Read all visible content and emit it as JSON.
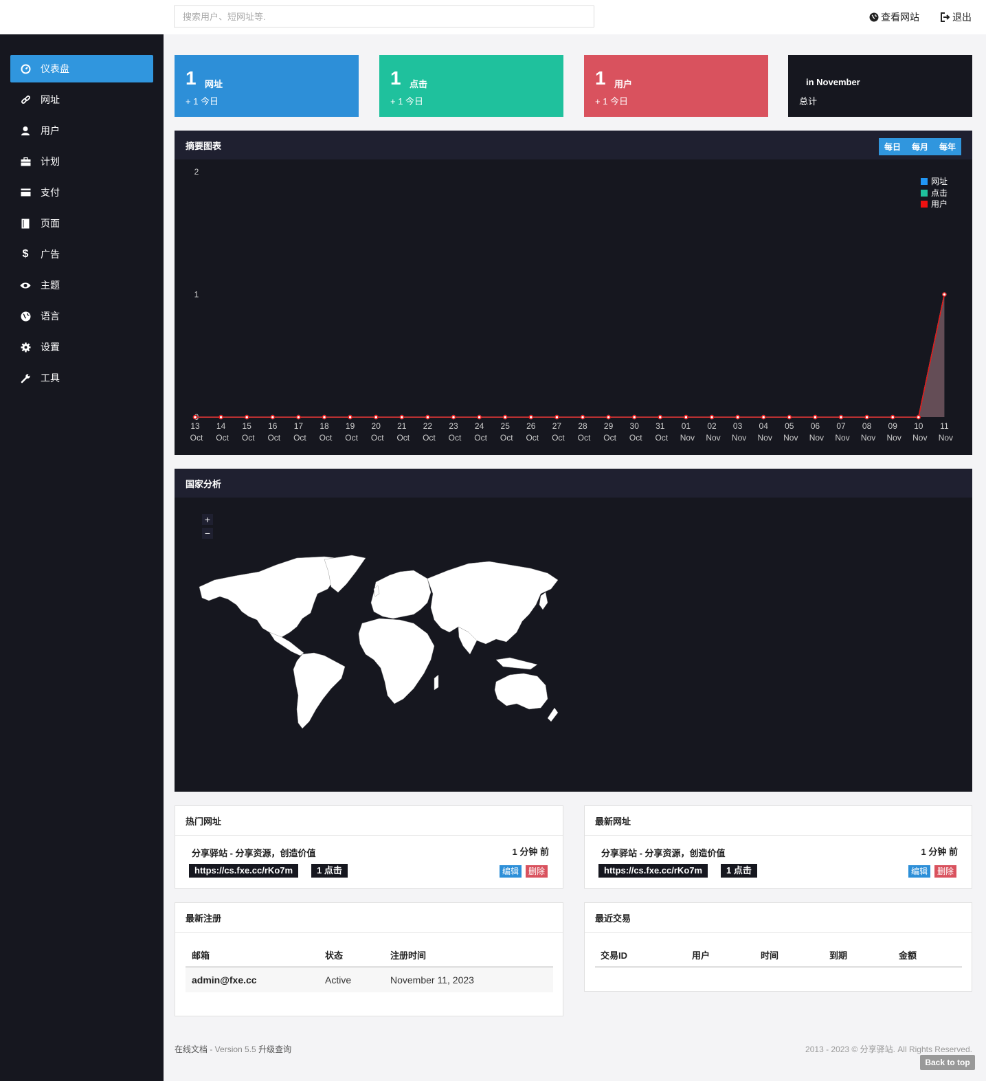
{
  "header": {
    "search_placeholder": "搜索用户、短网址等.",
    "view_site": "查看网站",
    "logout": "退出"
  },
  "sidebar": {
    "items": [
      {
        "label": "仪表盘",
        "icon": "dashboard-icon",
        "active": true
      },
      {
        "label": "网址",
        "icon": "link-icon"
      },
      {
        "label": "用户",
        "icon": "user-icon"
      },
      {
        "label": "计划",
        "icon": "briefcase-icon"
      },
      {
        "label": "支付",
        "icon": "credit-card-icon"
      },
      {
        "label": "页面",
        "icon": "page-icon"
      },
      {
        "label": "广告",
        "icon": "dollar-icon"
      },
      {
        "label": "主题",
        "icon": "eye-icon"
      },
      {
        "label": "语言",
        "icon": "globe-icon"
      },
      {
        "label": "设置",
        "icon": "gear-icon"
      },
      {
        "label": "工具",
        "icon": "wrench-icon"
      }
    ]
  },
  "stats": [
    {
      "num": "1",
      "label": "网址",
      "sub": "+ 1 今日",
      "color": "#2d8fd8"
    },
    {
      "num": "1",
      "label": "点击",
      "sub": "+ 1 今日",
      "color": "#1fc19d"
    },
    {
      "num": "1",
      "label": "用户",
      "sub": "+ 1 今日",
      "color": "#d9525e"
    },
    {
      "num": "",
      "label": "in November",
      "sub": "总计",
      "color": "#16171f"
    }
  ],
  "summary": {
    "title": "摘要图表",
    "periods": [
      "每日",
      "每月",
      "每年"
    ]
  },
  "chart_data": {
    "type": "area",
    "y_ticks": [
      "2",
      "1",
      "0"
    ],
    "ylim": [
      0,
      2
    ],
    "categories": [
      [
        "13",
        "Oct"
      ],
      [
        "14",
        "Oct"
      ],
      [
        "15",
        "Oct"
      ],
      [
        "16",
        "Oct"
      ],
      [
        "17",
        "Oct"
      ],
      [
        "18",
        "Oct"
      ],
      [
        "19",
        "Oct"
      ],
      [
        "20",
        "Oct"
      ],
      [
        "21",
        "Oct"
      ],
      [
        "22",
        "Oct"
      ],
      [
        "23",
        "Oct"
      ],
      [
        "24",
        "Oct"
      ],
      [
        "25",
        "Oct"
      ],
      [
        "26",
        "Oct"
      ],
      [
        "27",
        "Oct"
      ],
      [
        "28",
        "Oct"
      ],
      [
        "29",
        "Oct"
      ],
      [
        "30",
        "Oct"
      ],
      [
        "31",
        "Oct"
      ],
      [
        "01",
        "Nov"
      ],
      [
        "02",
        "Nov"
      ],
      [
        "03",
        "Nov"
      ],
      [
        "04",
        "Nov"
      ],
      [
        "05",
        "Nov"
      ],
      [
        "06",
        "Nov"
      ],
      [
        "07",
        "Nov"
      ],
      [
        "08",
        "Nov"
      ],
      [
        "09",
        "Nov"
      ],
      [
        "10",
        "Nov"
      ],
      [
        "11",
        "Nov"
      ]
    ],
    "series": [
      {
        "name": "网址",
        "color": "#2196f3",
        "values": [
          0,
          0,
          0,
          0,
          0,
          0,
          0,
          0,
          0,
          0,
          0,
          0,
          0,
          0,
          0,
          0,
          0,
          0,
          0,
          0,
          0,
          0,
          0,
          0,
          0,
          0,
          0,
          0,
          0,
          1
        ]
      },
      {
        "name": "点击",
        "color": "#1fc19d",
        "values": [
          0,
          0,
          0,
          0,
          0,
          0,
          0,
          0,
          0,
          0,
          0,
          0,
          0,
          0,
          0,
          0,
          0,
          0,
          0,
          0,
          0,
          0,
          0,
          0,
          0,
          0,
          0,
          0,
          0,
          1
        ]
      },
      {
        "name": "用户",
        "color": "#ee1111",
        "values": [
          0,
          0,
          0,
          0,
          0,
          0,
          0,
          0,
          0,
          0,
          0,
          0,
          0,
          0,
          0,
          0,
          0,
          0,
          0,
          0,
          0,
          0,
          0,
          0,
          0,
          0,
          0,
          0,
          0,
          1
        ]
      }
    ]
  },
  "country": {
    "title": "国家分析",
    "zoom_in": "+",
    "zoom_out": "−"
  },
  "popular": {
    "title": "热门网址",
    "item_title": "分享驿站 - 分享资源，创造价值",
    "time": "1 分钟 前",
    "url": "https://cs.fxe.cc/rKo7m",
    "clicks": "1 点击",
    "edit": "编辑",
    "delete": "删除"
  },
  "latest": {
    "title": "最新网址",
    "item_title": "分享驿站 - 分享资源，创造价值",
    "time": "1 分钟 前",
    "url": "https://cs.fxe.cc/rKo7m",
    "clicks": "1 点击",
    "edit": "编辑",
    "delete": "删除"
  },
  "registrations": {
    "title": "最新注册",
    "headers": [
      "邮箱",
      "状态",
      "注册时间"
    ],
    "rows": [
      [
        "admin@fxe.cc",
        "Active",
        "November 11, 2023"
      ]
    ]
  },
  "transactions": {
    "title": "最近交易",
    "headers": [
      "交易ID",
      "用户",
      "时间",
      "到期",
      "金额"
    ]
  },
  "footer": {
    "docs": "在线文档",
    "version": " - Version 5.5 ",
    "upgrade": "升级查询",
    "copyright": "2013 - 2023 © 分享驿站. All Rights Reserved.",
    "back_to_top": "Back to top"
  }
}
